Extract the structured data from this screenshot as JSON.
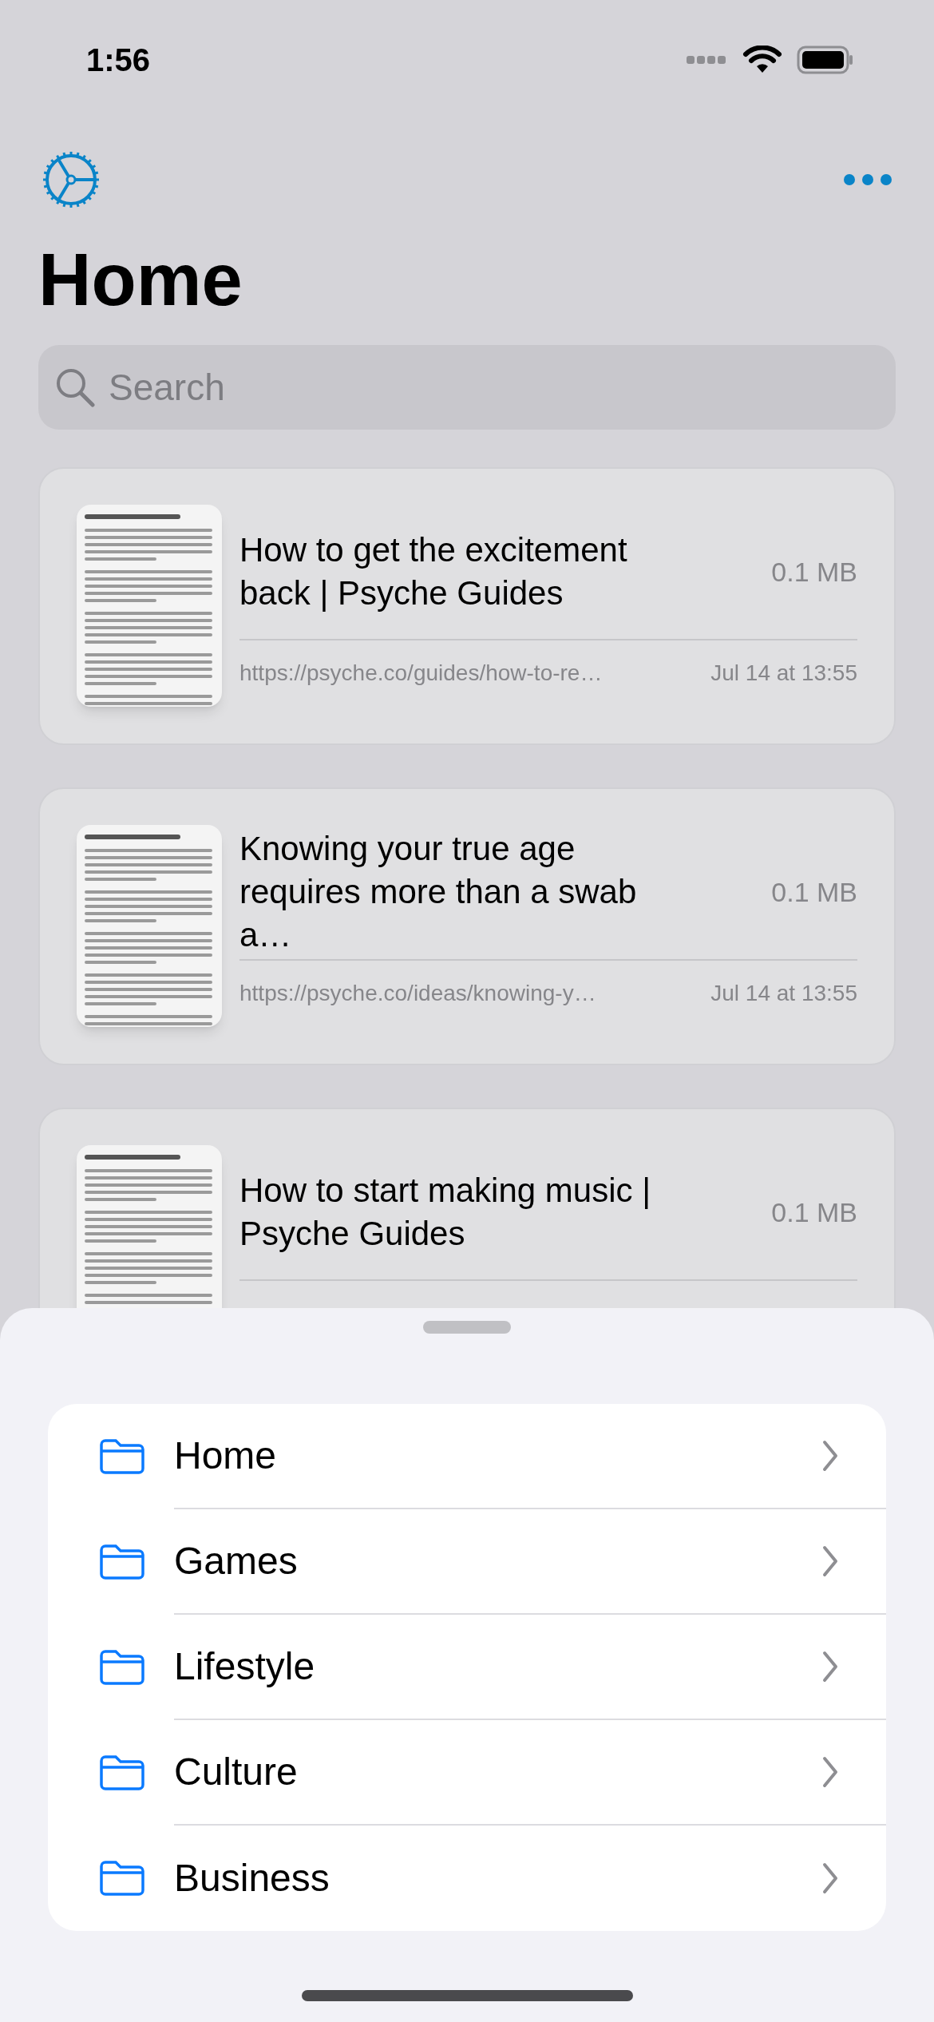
{
  "status_bar": {
    "time": "1:56"
  },
  "title": "Home",
  "search": {
    "placeholder": "Search"
  },
  "documents": [
    {
      "title": "How to get the excitement back | Psyche Guides",
      "size": "0.1 MB",
      "url": "https://psyche.co/guides/how-to-re…",
      "date": "Jul 14 at 13:55"
    },
    {
      "title": "Knowing your true age requires more than a swab a…",
      "size": "0.1 MB",
      "url": "https://psyche.co/ideas/knowing-y…",
      "date": "Jul 14 at 13:55"
    },
    {
      "title": "How to start making music | Psyche Guides",
      "size": "0.1 MB"
    }
  ],
  "sheet": {
    "folders": [
      {
        "name": "Home"
      },
      {
        "name": "Games"
      },
      {
        "name": "Lifestyle"
      },
      {
        "name": "Culture"
      },
      {
        "name": "Business"
      }
    ]
  }
}
